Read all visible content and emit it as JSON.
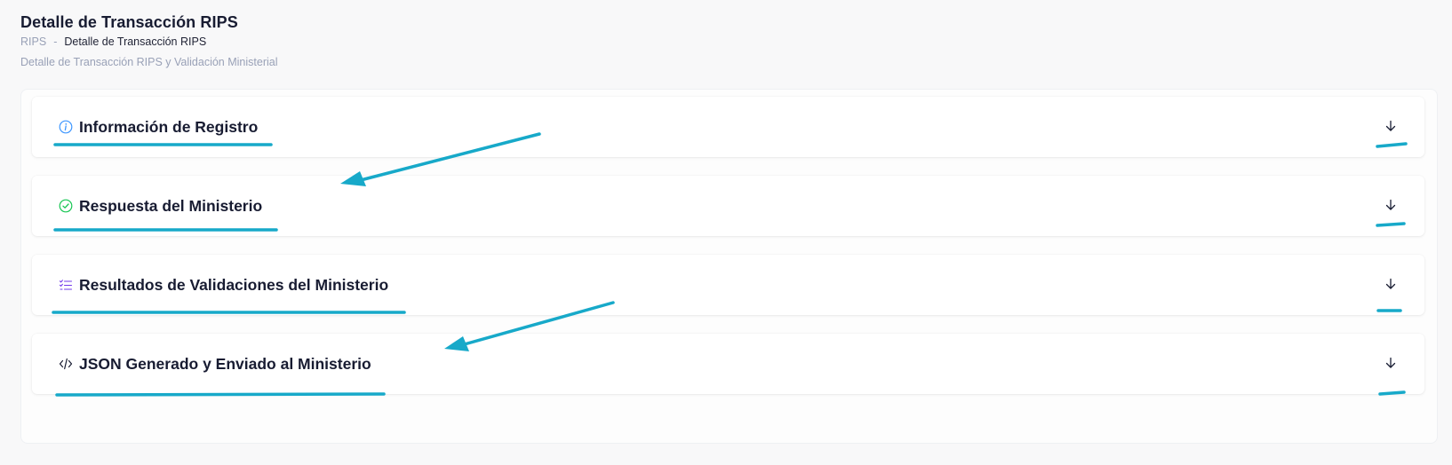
{
  "header": {
    "title": "Detalle de Transacción RIPS",
    "breadcrumb": {
      "root": "RIPS",
      "separator": "-",
      "current": "Detalle de Transacción RIPS"
    },
    "description": "Detalle de Transacción RIPS y Validación Ministerial"
  },
  "sections": [
    {
      "title": "Información de Registro",
      "icon": "info-icon",
      "icon_color": "#3e97ff"
    },
    {
      "title": "Respuesta del Ministerio",
      "icon": "check-circle-icon",
      "icon_color": "#17c653"
    },
    {
      "title": "Resultados de Validaciones del Ministerio",
      "icon": "checklist-icon",
      "icon_color": "#7239ea"
    },
    {
      "title": "JSON Generado y Enviado al Ministerio",
      "icon": "code-icon",
      "icon_color": "#181c32"
    }
  ],
  "annotation_color": "#17a9c9"
}
